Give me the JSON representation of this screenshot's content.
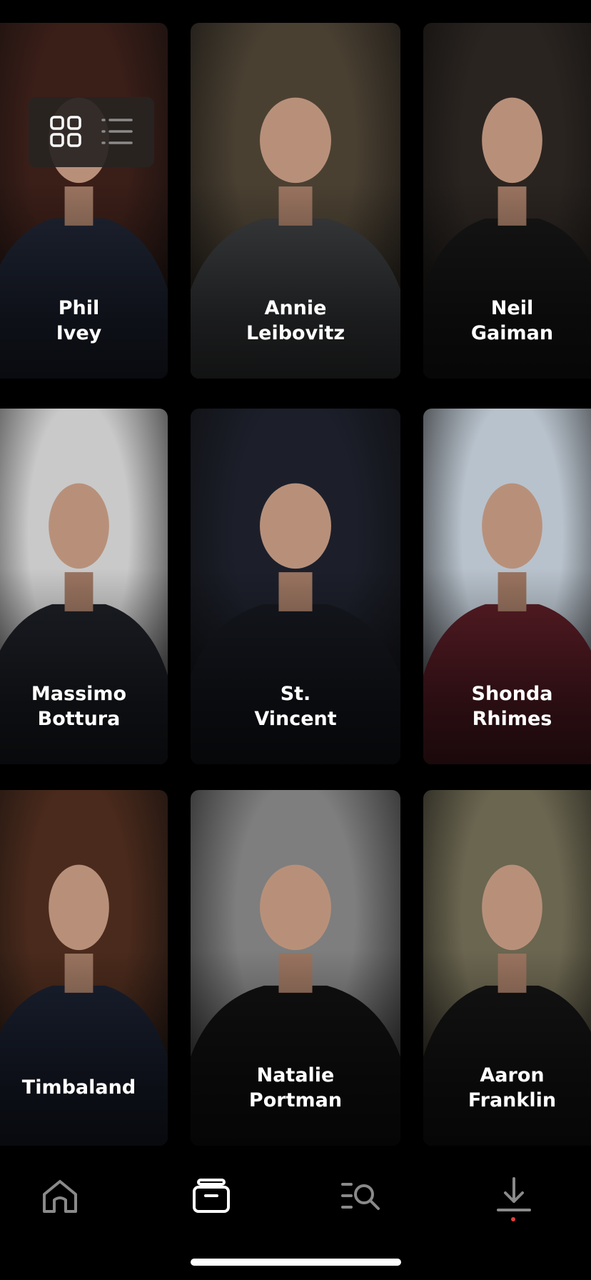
{
  "view_toggle": {
    "options": [
      {
        "icon": "grid-view-icon",
        "state": "selected"
      },
      {
        "icon": "list-view-icon",
        "state": "unselected"
      }
    ]
  },
  "instructors": [
    {
      "first": "Phil",
      "last": "Ivey",
      "bg": "#3a1e18",
      "accent": "#1e2433"
    },
    {
      "first": "Annie",
      "last": "Leibovitz",
      "bg": "#4a4032",
      "accent": "#3b3d3f"
    },
    {
      "first": "Neil",
      "last": "Gaiman",
      "bg": "#2a2420",
      "accent": "#161616"
    },
    {
      "first": "Massimo",
      "last": "Bottura",
      "bg": "#c9c9c9",
      "accent": "#1c1f26"
    },
    {
      "first": "St.",
      "last": "Vincent",
      "bg": "#1c1f2a",
      "accent": "#15181f"
    },
    {
      "first": "Shonda",
      "last": "Rhimes",
      "bg": "#b8c2cc",
      "accent": "#5a1d26"
    },
    {
      "first": "Timbaland",
      "last": "",
      "bg": "#4a2a1c",
      "accent": "#1a2030"
    },
    {
      "first": "Natalie",
      "last": "Portman",
      "bg": "#7e7e7e",
      "accent": "#111111"
    },
    {
      "first": "Aaron",
      "last": "Franklin",
      "bg": "#6b6650",
      "accent": "#141414"
    }
  ],
  "tabs": [
    {
      "icon": "home-icon",
      "state": "unselected"
    },
    {
      "icon": "library-icon",
      "state": "selected"
    },
    {
      "icon": "search-icon",
      "state": "unselected"
    },
    {
      "icon": "download-icon",
      "state": "unselected"
    }
  ],
  "colors": {
    "tab_selected": "#ffffff",
    "tab_unselected": "#8a8a8a",
    "download_dot": "#e0413a"
  }
}
